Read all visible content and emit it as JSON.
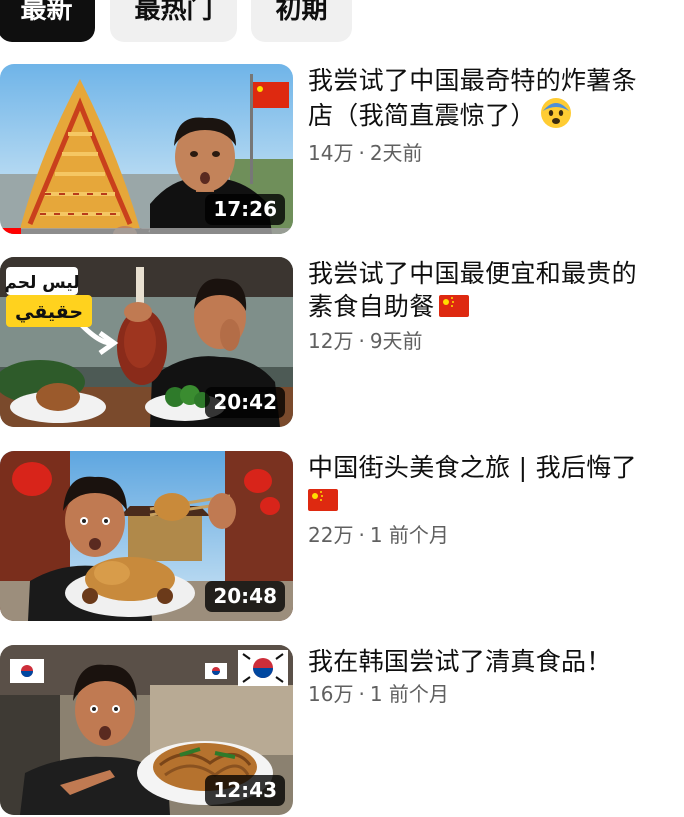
{
  "filter_chips": [
    {
      "label": "最新",
      "active": true
    },
    {
      "label": "最热门",
      "active": false
    },
    {
      "label": "初期",
      "active": false
    }
  ],
  "videos": [
    {
      "title": "我尝试了中国最奇特的炸薯条店（我简直震惊了）",
      "title_emoji": "fearful-face-emoji",
      "views": "14万",
      "age": "2天前",
      "duration": "17:26",
      "watch_progress": 0.07,
      "thumbnail": "man-with-huge-plate-of-fries-china-flag"
    },
    {
      "title": "我尝试了中国最便宜和最贵的素食自助餐",
      "title_emoji": "china-flag-emoji",
      "views": "12万",
      "age": "9天前",
      "duration": "20:42",
      "thumbnail": "man-holding-fake-meat-drumstick-arabic-caption",
      "thumbnail_text": "ليس لحم حقيقي"
    },
    {
      "title": "中国街头美食之旅 | 我后悔了",
      "title_emoji": "china-flag-emoji",
      "views": "22万",
      "age": "1 前个月",
      "duration": "20:48",
      "thumbnail": "man-with-roast-chicken-chinese-street"
    },
    {
      "title": "我在韩国尝试了清真食品！",
      "views": "16万",
      "age": "1 前个月",
      "duration": "12:43",
      "thumbnail": "man-pointing-at-noodles-korea-flags"
    }
  ],
  "separator": "·",
  "colors": {
    "chip_active_bg": "#0f0f0f",
    "chip_bg": "#f0f0f0",
    "meta_text": "#606060",
    "progress": "#ff0000",
    "flag_red": "#de2910",
    "flag_yellow": "#ffde00"
  }
}
